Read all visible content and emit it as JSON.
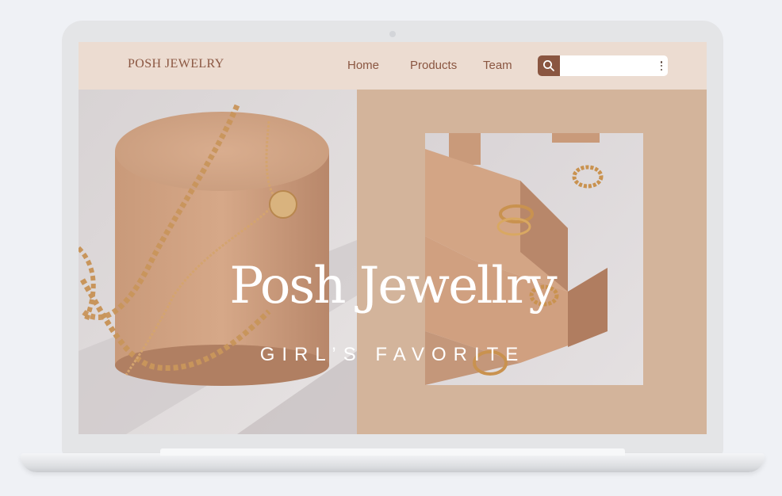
{
  "brand": "POSH JEWELRY",
  "nav": {
    "home": "Home",
    "products": "Products",
    "team": "Team"
  },
  "search": {
    "placeholder": "",
    "icon": "search-icon",
    "menu_icon": "more-vertical-icon"
  },
  "hero": {
    "title": "Posh Jewellry",
    "subtitle": "GIRL’S FAVORITE"
  },
  "colors": {
    "accent": "#8a5641",
    "nav_bg": "#ecdcd1",
    "panel_bg": "#d3b49b",
    "page_bg": "#eff1f5"
  }
}
